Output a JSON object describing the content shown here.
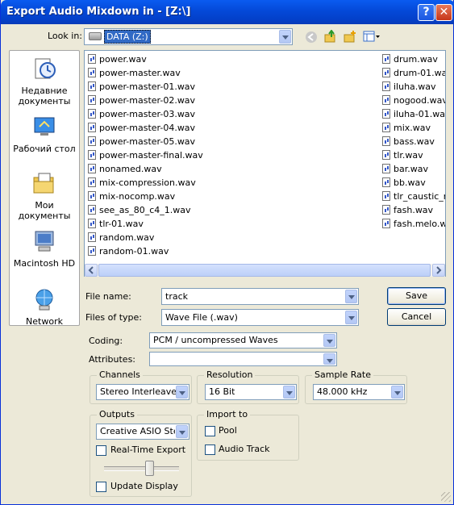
{
  "window": {
    "title": "Export Audio Mixdown in - [Z:\\]",
    "help_btn": "?",
    "close_btn": "✕"
  },
  "lookin": {
    "label": "Look in:",
    "value": "DATA (Z:)"
  },
  "places": [
    {
      "label_line1": "Недавние",
      "label_line2": "документы"
    },
    {
      "label_line1": "Рабочий стол",
      "label_line2": ""
    },
    {
      "label_line1": "Мои документы",
      "label_line2": ""
    },
    {
      "label_line1": "Macintosh HD",
      "label_line2": ""
    },
    {
      "label_line1": "Network",
      "label_line2": ""
    }
  ],
  "files_col1": [
    "power.wav",
    "power-master.wav",
    "power-master-01.wav",
    "power-master-02.wav",
    "power-master-03.wav",
    "power-master-04.wav",
    "power-master-05.wav",
    "power-master-final.wav",
    "nonamed.wav",
    "mix-compression.wav",
    "mix-nocomp.wav",
    "see_as_80_c4_1.wav",
    "tlr-01.wav",
    "random.wav",
    "random-01.wav"
  ],
  "files_col2": [
    "drum.wav",
    "drum-01.wav",
    "iluha.wav",
    "nogood.wav",
    "iluha-01.wav",
    "mix.wav",
    "bass.wav",
    "tlr.wav",
    "bar.wav",
    "bb.wav",
    "tlr_caustic_re",
    "fash.wav",
    "fash.melo.wa"
  ],
  "filename": {
    "label": "File name:",
    "value": "track"
  },
  "filetype": {
    "label": "Files of type:",
    "value": "Wave File (.wav)"
  },
  "buttons": {
    "save": "Save",
    "cancel": "Cancel"
  },
  "coding": {
    "label": "Coding:",
    "value": "PCM / uncompressed Waves"
  },
  "attributes": {
    "label": "Attributes:",
    "value": ""
  },
  "channels": {
    "label": "Channels",
    "value": "Stereo Interleaved"
  },
  "resolution": {
    "label": "Resolution",
    "value": "16 Bit"
  },
  "samplerate": {
    "label": "Sample Rate",
    "value": "48.000 kHz"
  },
  "outputs": {
    "label": "Outputs",
    "value": "Creative ASIO Stereo",
    "realtime": "Real-Time Export",
    "update": "Update Display"
  },
  "importto": {
    "label": "Import to",
    "pool": "Pool",
    "audiotrack": "Audio Track"
  }
}
